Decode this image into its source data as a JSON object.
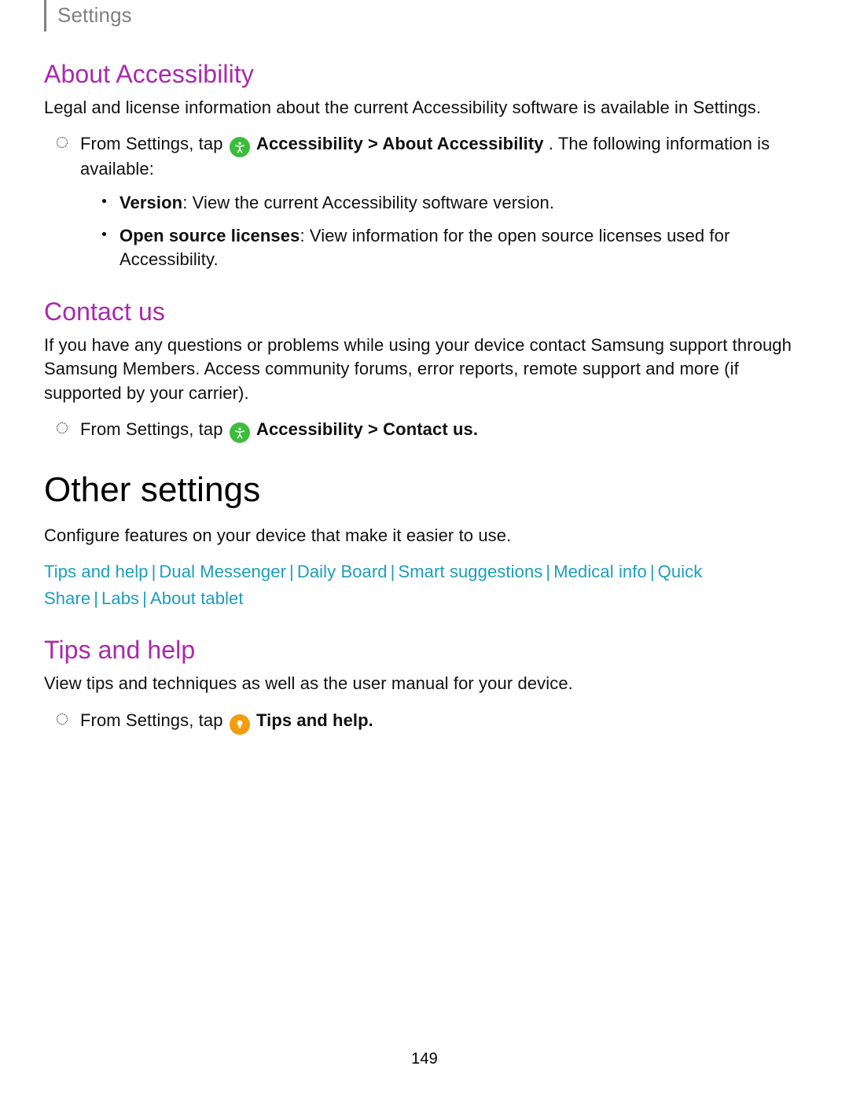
{
  "header": {
    "title": "Settings"
  },
  "about": {
    "heading": "About Accessibility",
    "intro": "Legal and license information about the current Accessibility software is available in Settings.",
    "step_prefix": "From Settings, tap ",
    "step_bold": "Accessibility > About Accessibility",
    "step_suffix": ". The following information is available:",
    "bullets": [
      {
        "label": "Version",
        "text": ": View the current Accessibility software version."
      },
      {
        "label": "Open source licenses",
        "text": ": View information for the open source licenses used for Accessibility."
      }
    ]
  },
  "contact": {
    "heading": "Contact us",
    "intro": "If you have any questions or problems while using your device contact Samsung support through Samsung Members. Access community forums, error reports, remote support and more (if supported by your carrier).",
    "step_prefix": "From Settings, tap ",
    "step_bold": "Accessibility > Contact us."
  },
  "other": {
    "heading": "Other settings",
    "intro": "Configure features on your device that make it easier to use.",
    "links": [
      "Tips and help",
      "Dual Messenger",
      "Daily Board",
      "Smart suggestions",
      "Medical info",
      "Quick Share",
      "Labs",
      "About tablet"
    ]
  },
  "tips": {
    "heading": "Tips and help",
    "intro": "View tips and techniques as well as the user manual for your device.",
    "step_prefix": "From Settings, tap ",
    "step_bold": "Tips and help."
  },
  "icons": {
    "accessibility": "accessibility-icon",
    "tips": "lightbulb-icon"
  },
  "page_number": "149"
}
